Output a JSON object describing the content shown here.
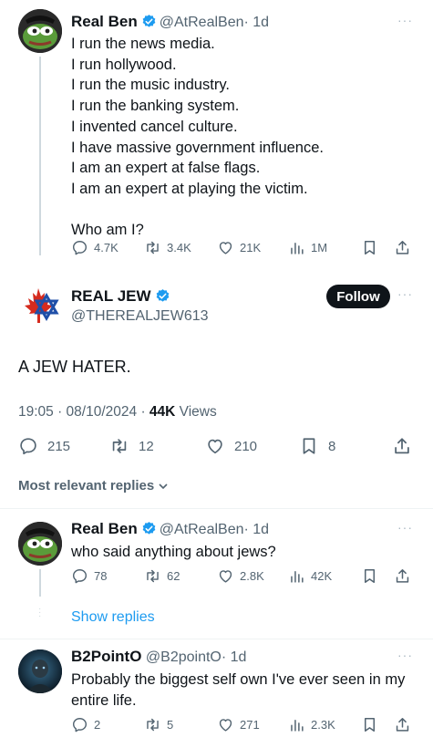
{
  "tweet1": {
    "name": "Real Ben",
    "handle": "@AtRealBen",
    "time": "· 1d",
    "lines": [
      "I run the news media.",
      "I run hollywood.",
      "I run the music industry.",
      "I run the banking system.",
      "I invented cancel culture.",
      "I have massive government influence.",
      "I am an expert at false flags.",
      "I am an expert at playing the victim."
    ],
    "question": "Who am I?",
    "stats": {
      "replies": "4.7K",
      "retweets": "3.4K",
      "likes": "21K",
      "views": "1M"
    }
  },
  "main": {
    "name": "REAL JEW",
    "handle": "@THEREALJEW613",
    "follow_label": "Follow",
    "text": "A JEW HATER.",
    "datetime": "19:05 · 08/10/2024 · ",
    "views_count": "44K",
    "views_label": " Views",
    "stats": {
      "replies": "215",
      "retweets": "12",
      "likes": "210",
      "bookmarks": "8"
    },
    "sort_label": "Most relevant replies"
  },
  "reply1": {
    "name": "Real Ben",
    "handle": "@AtRealBen",
    "time": "· 1d",
    "text": "who said anything about jews?",
    "stats": {
      "replies": "78",
      "retweets": "62",
      "likes": "2.8K",
      "views": "42K"
    },
    "show_replies": "Show replies"
  },
  "reply2": {
    "name": "B2PointO",
    "handle": "@B2pointO",
    "time": "· 1d",
    "text_line1": "Probably the biggest self own I've ever seen in my",
    "text_line2": "entire life.",
    "stats": {
      "replies": "2",
      "retweets": "5",
      "likes": "271",
      "views": "2.3K"
    }
  },
  "colors": {
    "accent": "#1d9bf0",
    "muted": "#536471",
    "text": "#0f1419",
    "canada_red": "#d52b1e",
    "star_blue": "#1f4fa8"
  },
  "icons": [
    "reply-icon",
    "retweet-icon",
    "like-icon",
    "views-icon",
    "bookmark-icon",
    "share-icon",
    "verified-icon",
    "more-icon"
  ]
}
